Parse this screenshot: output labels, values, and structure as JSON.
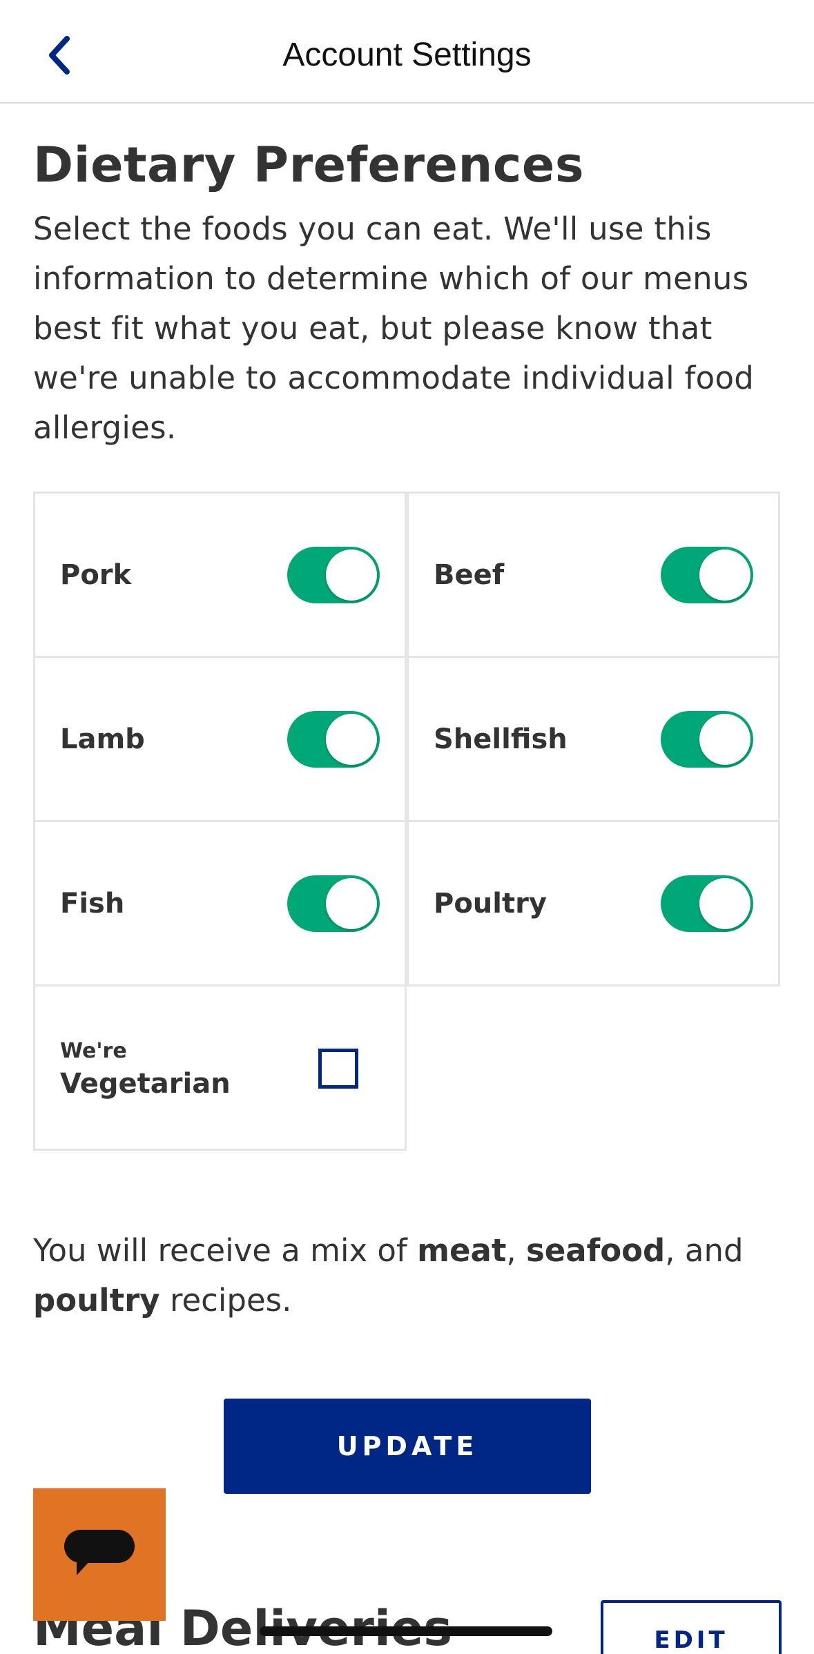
{
  "header": {
    "title": "Account Settings"
  },
  "dietary": {
    "title": "Dietary Preferences",
    "description": "Select the foods you can eat. We'll use this information to determine which of our menus best fit what you eat, but please know that we're unable to accommodate individual food allergies.",
    "items": [
      {
        "label": "Pork",
        "enabled": true
      },
      {
        "label": "Beef",
        "enabled": true
      },
      {
        "label": "Lamb",
        "enabled": true
      },
      {
        "label": "Shellfish",
        "enabled": true
      },
      {
        "label": "Fish",
        "enabled": true
      },
      {
        "label": "Poultry",
        "enabled": true
      }
    ],
    "vegetarian": {
      "small_label": "We're",
      "label": "Vegetarian",
      "checked": false
    },
    "summary": {
      "prefix": "You will receive a mix of ",
      "meat": "meat",
      "sep1": ", ",
      "seafood": "seafood",
      "sep2": ", and ",
      "poultry": "poultry",
      "suffix": " recipes."
    },
    "update_label": "UPDATE"
  },
  "meal": {
    "title": "Meal Deliveries",
    "edit_label": "EDIT"
  },
  "colors": {
    "toggle_on": "#00a878",
    "primary": "#002785",
    "chat": "#e07424"
  }
}
